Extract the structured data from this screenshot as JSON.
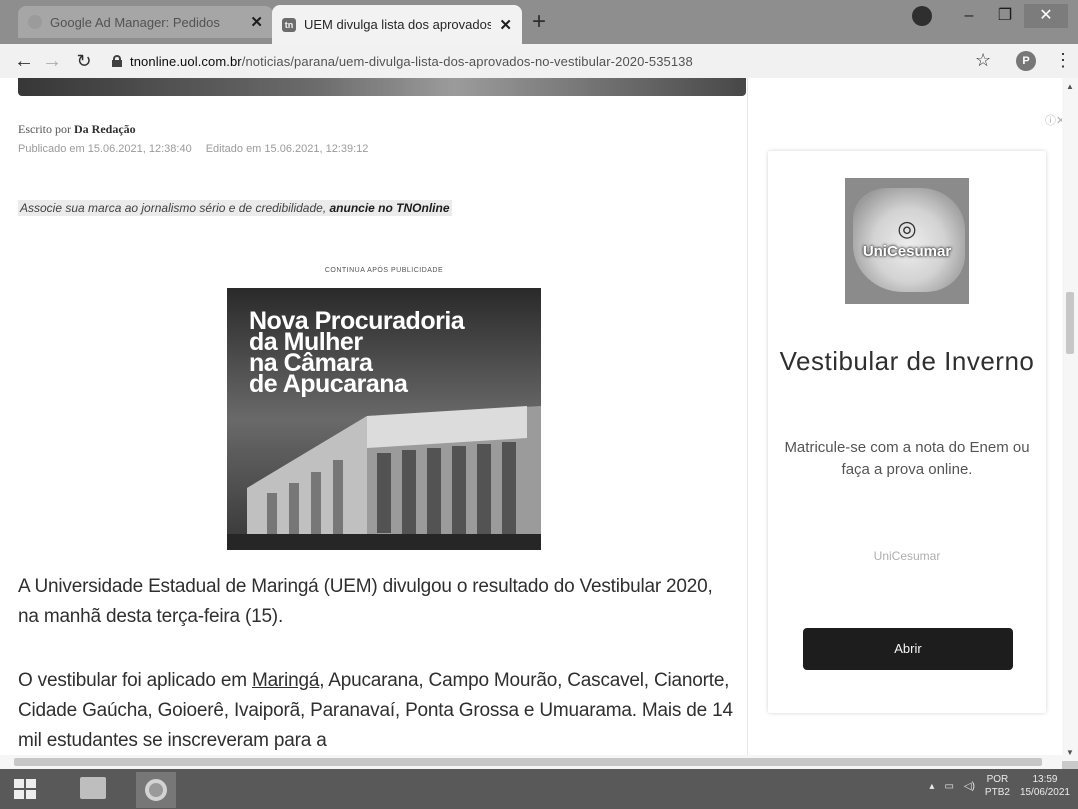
{
  "browser": {
    "tabs": [
      {
        "label": "Google Ad Manager: Pedidos",
        "active": false
      },
      {
        "label": "UEM divulga lista dos aprovados",
        "active": true
      }
    ],
    "favicon_letter": "tn",
    "new_tab": "+",
    "url_host": "tnonline.uol.com.br",
    "url_path": "/noticias/parana/uem-divulga-lista-dos-aprovados-no-vestibular-2020-535138",
    "profile_initial": "P"
  },
  "article": {
    "byline_prefix": "Escrito por",
    "author": "Da Redação",
    "published": "Publicado em 15.06.2021, 12:38:40",
    "edited": "Editado em 15.06.2021, 12:39:12",
    "promo_text": "Associe sua marca ao jornalismo sério e de credibilidade,",
    "promo_link": "anuncie no TNOnline",
    "ad_label": "CONTINUA APÓS PUBLICIDADE",
    "ad_headline": [
      "Nova Procuradoria",
      "da Mulher",
      "na Câmara",
      "de Apucarana"
    ],
    "paragraph1": "A Universidade Estadual de Maringá (UEM) divulgou o resultado do Vestibular 2020, na manhã desta terça-feira (15).",
    "paragraph2_before": "O vestibular foi aplicado em ",
    "paragraph2_link": "Maringá",
    "paragraph2_after": ", Apucarana, Campo Mourão, Cascavel, Cianorte, Cidade Gaúcha, Goioerê, Ivaiporã, Paranavaí, Ponta Grossa e Umuarama. Mais de 14 mil estudantes se inscreveram para a"
  },
  "sidebar_ad": {
    "close_glyphs": "ⓘ✕",
    "logo_brand": "UniCesumar",
    "title": "Vestibular de Inverno",
    "text": "Matricule-se com a nota do Enem ou faça a prova online.",
    "source": "UniCesumar",
    "button": "Abrir"
  },
  "taskbar": {
    "lang_top": "POR",
    "lang_bottom": "PTB2",
    "time": "13:59",
    "date": "15/06/2021"
  }
}
